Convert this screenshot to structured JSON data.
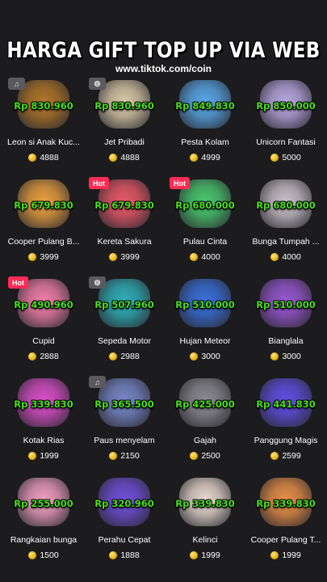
{
  "header": {
    "title": "HARGA GIFT TOP UP VIA WEB",
    "subtitle": "www.tiktok.com/coin"
  },
  "gifts": [
    {
      "name": "Leon si Anak Kuc...",
      "price": "Rp 830.960",
      "coins": "4888",
      "badge": "music",
      "badge_text": "♫",
      "color": "#b0772a"
    },
    {
      "name": "Jet Pribadi",
      "price": "Rp 830.960",
      "coins": "4888",
      "badge": "palette",
      "badge_text": "◍",
      "color": "#d9c9a8"
    },
    {
      "name": "Pesta Kolam",
      "price": "Rp 849.830",
      "coins": "4999",
      "badge": "",
      "badge_text": "",
      "color": "#5aa8e8"
    },
    {
      "name": "Unicorn Fantasi",
      "price": "Rp 850.000",
      "coins": "5000",
      "badge": "",
      "badge_text": "",
      "color": "#b8a8e0"
    },
    {
      "name": "Cooper Pulang B...",
      "price": "Rp 679.830",
      "coins": "3999",
      "badge": "",
      "badge_text": "",
      "color": "#e8a040"
    },
    {
      "name": "Kereta Sakura",
      "price": "Rp 679.830",
      "coins": "3999",
      "badge": "hot",
      "badge_text": "Hot",
      "color": "#e85a6a"
    },
    {
      "name": "Pulau Cinta",
      "price": "Rp 680.000",
      "coins": "4000",
      "badge": "hot",
      "badge_text": "Hot",
      "color": "#4ac870"
    },
    {
      "name": "Bunga Tumpah ...",
      "price": "Rp 680.000",
      "coins": "4000",
      "badge": "",
      "badge_text": "",
      "color": "#c8c0c8"
    },
    {
      "name": "Cupid",
      "price": "Rp 490.960",
      "coins": "2888",
      "badge": "hot",
      "badge_text": "Hot",
      "color": "#f080a8"
    },
    {
      "name": "Sepeda Motor",
      "price": "Rp 507.960",
      "coins": "2988",
      "badge": "palette",
      "badge_text": "◍",
      "color": "#30b0b8"
    },
    {
      "name": "Hujan Meteor",
      "price": "Rp 510.000",
      "coins": "3000",
      "badge": "",
      "badge_text": "",
      "color": "#3a70d8"
    },
    {
      "name": "Bianglala",
      "price": "Rp 510.000",
      "coins": "3000",
      "badge": "",
      "badge_text": "",
      "color": "#9858d0"
    },
    {
      "name": "Kotak Rias",
      "price": "Rp 339.830",
      "coins": "1999",
      "badge": "",
      "badge_text": "",
      "color": "#d850c8"
    },
    {
      "name": "Paus menyelam",
      "price": "Rp 365.500",
      "coins": "2150",
      "badge": "music",
      "badge_text": "♫",
      "color": "#7888c8"
    },
    {
      "name": "Gajah",
      "price": "Rp 425.000",
      "coins": "2500",
      "badge": "",
      "badge_text": "",
      "color": "#8a8a90"
    },
    {
      "name": "Panggung Magis",
      "price": "Rp 441.830",
      "coins": "2599",
      "badge": "",
      "badge_text": "",
      "color": "#6050e0"
    },
    {
      "name": "Rangkaian bunga",
      "price": "Rp 255.000",
      "coins": "1500",
      "badge": "",
      "badge_text": "",
      "color": "#f0a0c0"
    },
    {
      "name": "Perahu Cepat",
      "price": "Rp 320.960",
      "coins": "1888",
      "badge": "",
      "badge_text": "",
      "color": "#7050d8"
    },
    {
      "name": "Kelinci",
      "price": "Rp 339.830",
      "coins": "1999",
      "badge": "",
      "badge_text": "",
      "color": "#e8d8d0"
    },
    {
      "name": "Cooper Pulang T...",
      "price": "Rp 339.830",
      "coins": "1999",
      "badge": "",
      "badge_text": "",
      "color": "#e89048"
    }
  ]
}
